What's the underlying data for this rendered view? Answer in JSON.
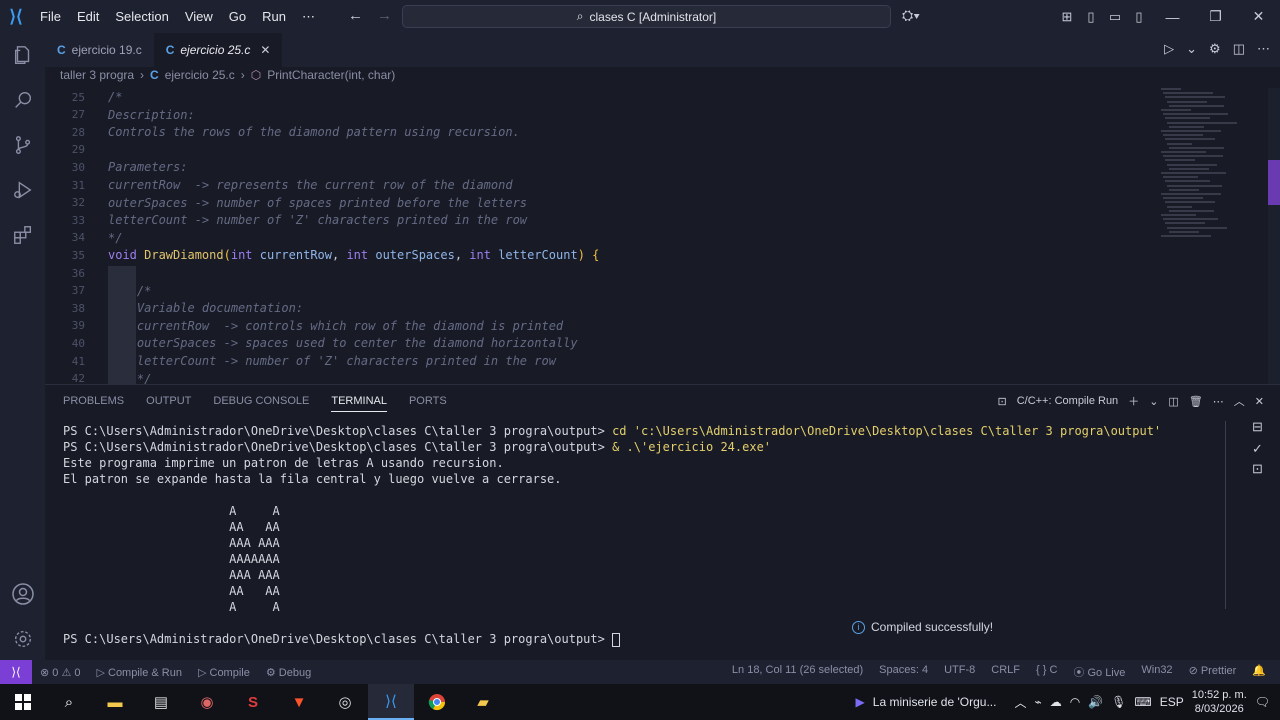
{
  "titlebar": {
    "menu": [
      "File",
      "Edit",
      "Selection",
      "View",
      "Go",
      "Run",
      "⋯"
    ],
    "search": "clases C [Administrator]"
  },
  "tabs": [
    {
      "icon": "C",
      "label": "ejercicio 19.c"
    },
    {
      "icon": "C",
      "label": "ejercicio 25.c",
      "active": true
    }
  ],
  "breadcrumb": {
    "folder": "taller 3 progra",
    "file": "ejercicio 25.c",
    "symbol": "PrintCharacter(int, char)"
  },
  "editor": {
    "lines": [
      {
        "n": "25",
        "parts": [
          {
            "c": "cm",
            "t": "/*"
          }
        ]
      },
      {
        "n": "27",
        "parts": [
          {
            "c": "cm",
            "t": "Description:"
          }
        ]
      },
      {
        "n": "28",
        "parts": [
          {
            "c": "cm",
            "t": "Controls the rows of the diamond pattern using recursion."
          }
        ]
      },
      {
        "n": "29",
        "parts": []
      },
      {
        "n": "30",
        "parts": [
          {
            "c": "cm",
            "t": "Parameters:"
          }
        ]
      },
      {
        "n": "31",
        "parts": [
          {
            "c": "cm",
            "t": "currentRow  -> represents the current row of the diamond"
          }
        ]
      },
      {
        "n": "32",
        "parts": [
          {
            "c": "cm",
            "t": "outerSpaces -> number of spaces printed before the letters"
          }
        ]
      },
      {
        "n": "33",
        "parts": [
          {
            "c": "cm",
            "t": "letterCount -> number of 'Z' characters printed in the row"
          }
        ]
      },
      {
        "n": "34",
        "parts": [
          {
            "c": "cm",
            "t": "*/"
          }
        ]
      },
      {
        "n": "35",
        "parts": [
          {
            "c": "kw",
            "t": "void "
          },
          {
            "c": "fnc",
            "t": "DrawDiamond"
          },
          {
            "c": "br",
            "t": "("
          },
          {
            "c": "kw",
            "t": "int "
          },
          {
            "c": "id",
            "t": "currentRow"
          },
          {
            "c": "pn",
            "t": ", "
          },
          {
            "c": "kw",
            "t": "int "
          },
          {
            "c": "id",
            "t": "outerSpaces"
          },
          {
            "c": "pn",
            "t": ", "
          },
          {
            "c": "kw",
            "t": "int "
          },
          {
            "c": "id",
            "t": "letterCount"
          },
          {
            "c": "br",
            "t": ")"
          },
          {
            "c": "pn",
            "t": " "
          },
          {
            "c": "br",
            "t": "{"
          }
        ]
      },
      {
        "n": "36",
        "parts": []
      },
      {
        "n": "37",
        "parts": [
          {
            "c": "cm",
            "t": "    /*"
          }
        ]
      },
      {
        "n": "38",
        "parts": [
          {
            "c": "cm",
            "t": "    Variable documentation:"
          }
        ]
      },
      {
        "n": "39",
        "parts": [
          {
            "c": "cm",
            "t": "    currentRow  -> controls which row of the diamond is printed"
          }
        ]
      },
      {
        "n": "40",
        "parts": [
          {
            "c": "cm",
            "t": "    outerSpaces -> spaces used to center the diamond horizontally"
          }
        ]
      },
      {
        "n": "41",
        "parts": [
          {
            "c": "cm",
            "t": "    letterCount -> number of 'Z' characters printed in the row"
          }
        ]
      },
      {
        "n": "42",
        "parts": [
          {
            "c": "cm",
            "t": "    */"
          }
        ]
      }
    ]
  },
  "panel": {
    "tabs": [
      "PROBLEMS",
      "OUTPUT",
      "DEBUG CONSOLE",
      "TERMINAL",
      "PORTS"
    ],
    "active_tab": "TERMINAL",
    "terminal_name": "C/C++: Compile Run"
  },
  "terminal": {
    "line1_prompt": "PS C:\\Users\\Administrador\\OneDrive\\Desktop\\clases C\\taller 3 progra\\output> ",
    "line1_cmd": "cd 'c:\\Users\\Administrador\\OneDrive\\Desktop\\clases C\\taller 3 progra\\output'",
    "line2_prompt": "PS C:\\Users\\Administrador\\OneDrive\\Desktop\\clases C\\taller 3 progra\\output> ",
    "line2_cmd": "& .\\'ejercicio 24.exe'",
    "out1": "Este programa imprime un patron de letras A usando recursion.",
    "out2": "El patron se expande hasta la fila central y luego vuelve a cerrarse.",
    "pattern": [
      "A     A",
      "AA   AA",
      "AAA AAA",
      "AAAAAAA",
      "AAA AAA",
      "AA   AA",
      "A     A"
    ],
    "final_prompt": "PS C:\\Users\\Administrador\\OneDrive\\Desktop\\clases C\\taller 3 progra\\output> "
  },
  "toast": "Compiled successfully!",
  "statusbar": {
    "problems": "⊗ 0 ⚠ 0",
    "compile_run": "▷ Compile & Run",
    "compile": "▷ Compile",
    "debug": "⚙ Debug",
    "position": "Ln 18, Col 11 (26 selected)",
    "spaces": "Spaces: 4",
    "encoding": "UTF-8",
    "eol": "CRLF",
    "lang": "{ } C",
    "golive": "⦿ Go Live",
    "platform": "Win32",
    "prettier": "⊘ Prettier"
  },
  "taskbar": {
    "media": "La miniserie de 'Orgu...",
    "lang": "ESP",
    "time": "10:52 p. m.",
    "date": "8/03/2026"
  },
  "colors": {
    "accent": "#7b3fd6",
    "keyword": "#9d7ff0",
    "function": "#e1c46c",
    "comment": "#656b85"
  }
}
